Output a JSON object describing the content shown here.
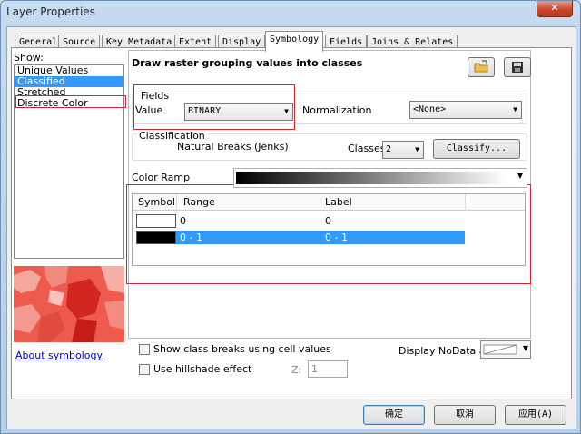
{
  "window": {
    "title": "Layer Properties",
    "close_glyph": "✕"
  },
  "tabs": [
    {
      "label": "General"
    },
    {
      "label": "Source"
    },
    {
      "label": "Key Metadata"
    },
    {
      "label": "Extent"
    },
    {
      "label": "Display"
    },
    {
      "label": "Symbology"
    },
    {
      "label": "Fields"
    },
    {
      "label": "Joins & Relates"
    }
  ],
  "show": {
    "label": "Show:",
    "items": [
      "Unique Values",
      "Classified",
      "Stretched",
      "Discrete Color"
    ],
    "selected": "Classified"
  },
  "about_link": "About symbology",
  "main": {
    "heading": "Draw raster grouping values into classes",
    "fields": {
      "group_label": "Fields",
      "value_label": "Value",
      "value": "BINARY",
      "normalization_label": "Normalization",
      "normalization": "<None>"
    },
    "classification": {
      "group_label": "Classification",
      "method": "Natural Breaks (Jenks)",
      "classes_label": "Classes",
      "classes": "2",
      "classify_button": "Classify..."
    },
    "color_ramp_label": "Color Ramp",
    "table": {
      "headers": {
        "symbol": "Symbol",
        "range": "Range",
        "label": "Label"
      },
      "rows": [
        {
          "range": "0",
          "label": "0",
          "color": "#ffffff"
        },
        {
          "range": "0 - 1",
          "label": "0 - 1",
          "color": "#000000"
        }
      ]
    },
    "show_class_breaks": "Show class breaks using cell values",
    "use_hillshade": "Use hillshade effect",
    "z_label": "Z:",
    "z_value": "1",
    "display_nodata_label": "Display NoData as"
  },
  "buttons": {
    "ok": "确定",
    "cancel": "取消",
    "apply": "应用(A)"
  },
  "colors": {
    "selection": "#3399ff",
    "highlight_box": "#d0282f",
    "preview_red": "#e8453c"
  }
}
